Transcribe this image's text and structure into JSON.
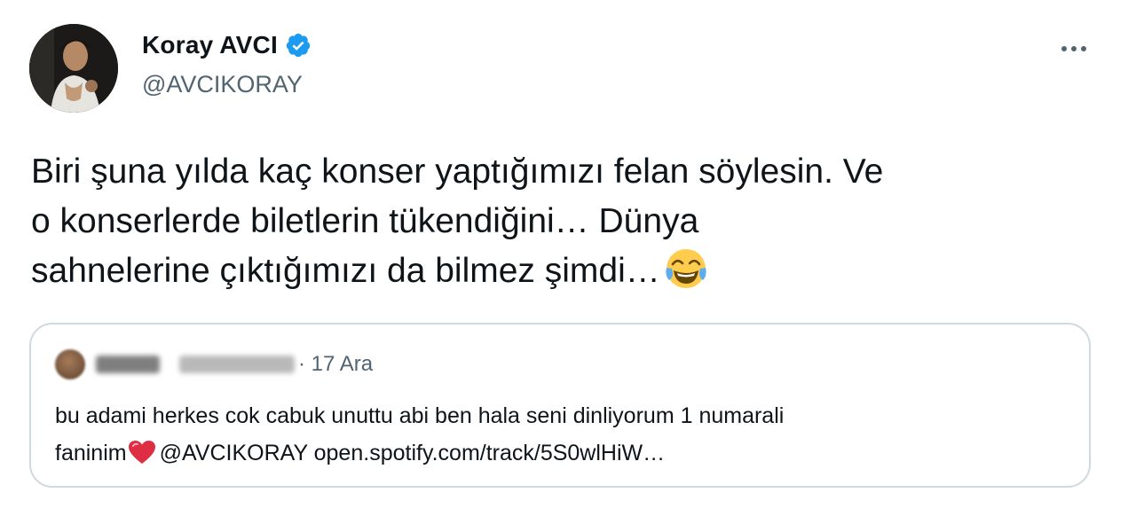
{
  "author": {
    "display_name": "Koray AVCI",
    "handle": "@AVCIKORAY",
    "verified": true,
    "avatar_icon": "profile-photo"
  },
  "more_icon": "more-dots-icon",
  "tweet": {
    "lines": [
      "Biri şuna yılda kaç konser yaptığımızı felan söylesin. Ve",
      "o konserlerde biletlerin tükendiğini… Dünya",
      "sahnelerine çıktığımızı da bilmez şimdi…"
    ],
    "emoji": "face-with-tears-of-joy"
  },
  "quoted_tweet": {
    "date": "· 17 Ara",
    "line1": "bu adami herkes cok cabuk unuttu abi ben hala seni dinliyorum 1 numarali",
    "line2_prefix": "faninim",
    "line2_suffix": "@AVCIKORAY open.spotify.com/track/5S0wlHiW…",
    "emoji": "red-heart"
  },
  "colors": {
    "text": "#0f1419",
    "secondary": "#536471",
    "verified_blue": "#1d9bf0",
    "border": "#cfd9de"
  }
}
